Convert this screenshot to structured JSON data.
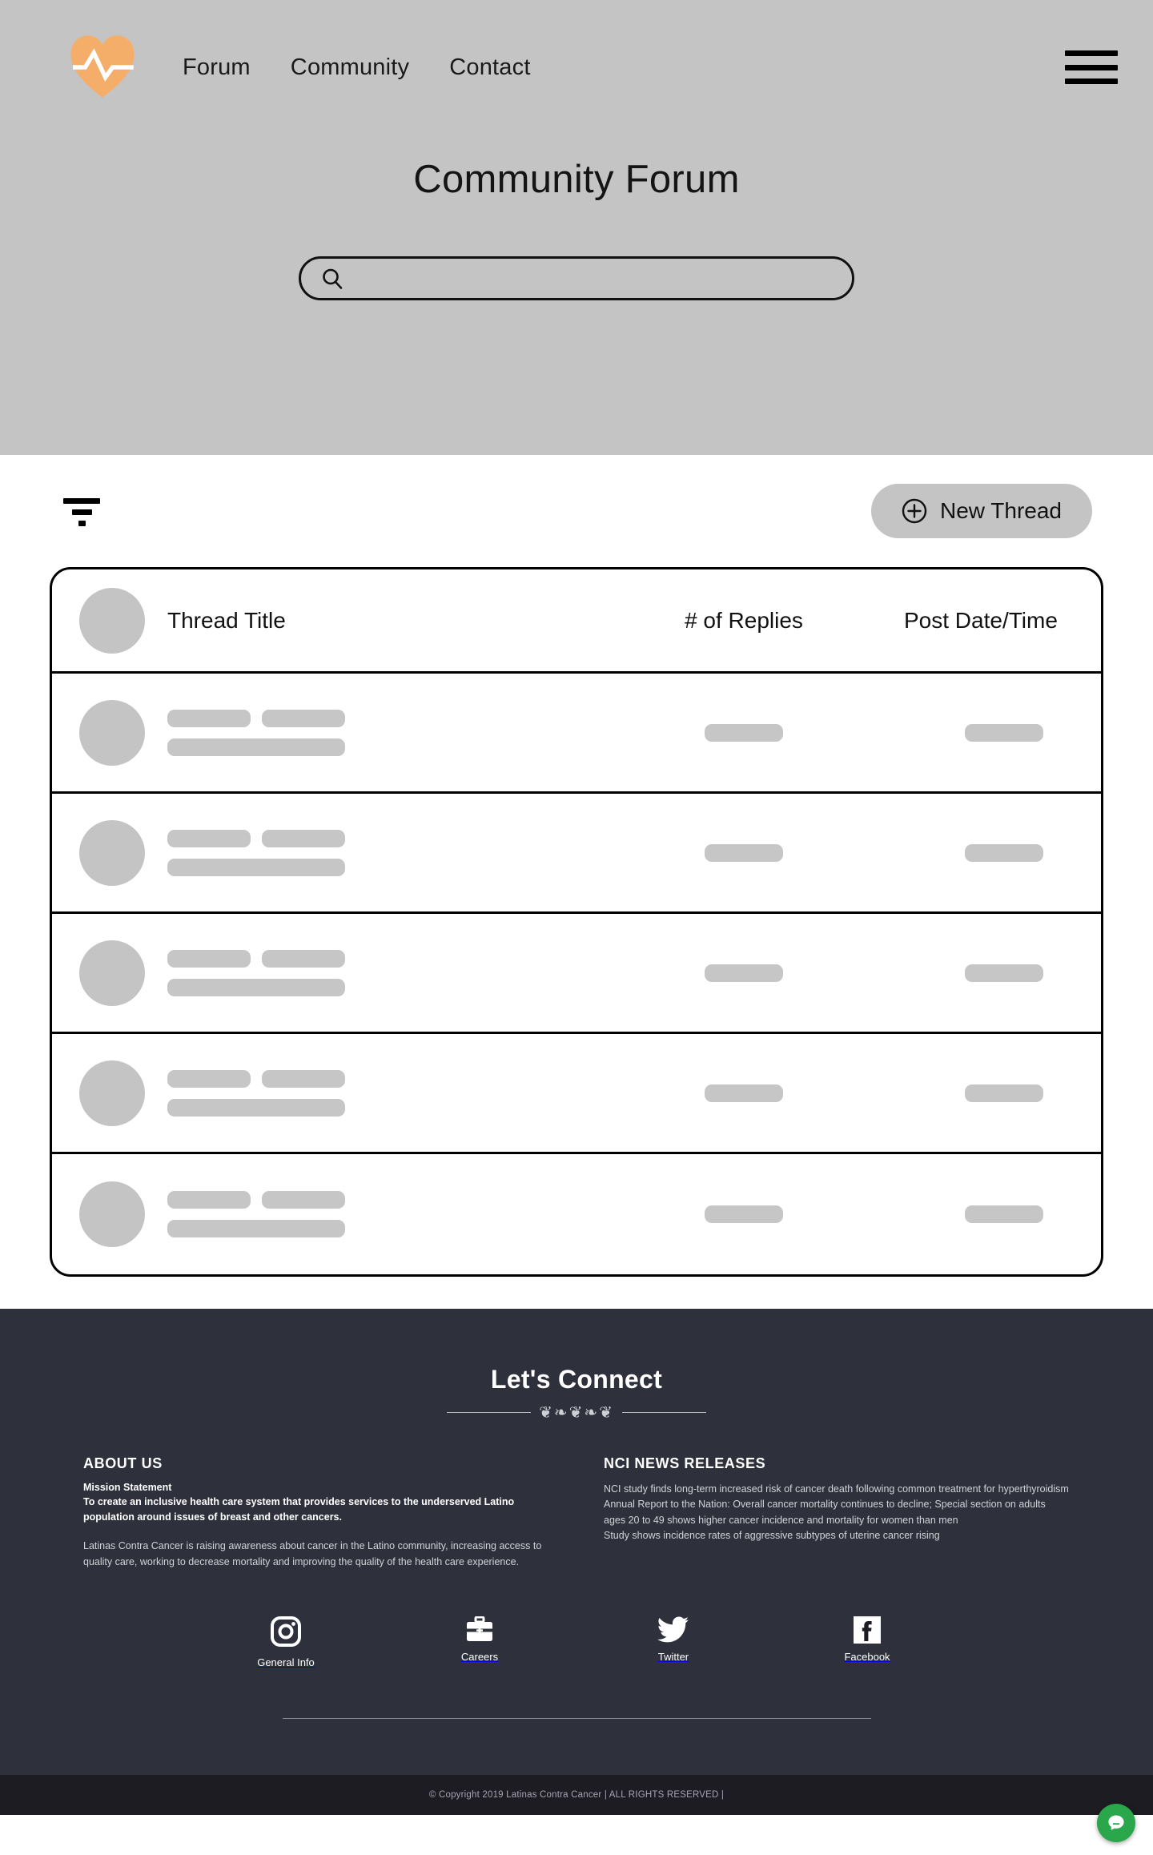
{
  "nav": {
    "logo_alt": "Latinas Contra Cancer heart-pulse logo",
    "links": [
      {
        "label": "Forum"
      },
      {
        "label": "Community"
      },
      {
        "label": "Contact"
      }
    ],
    "menu_label": "Menu"
  },
  "hero": {
    "title": "Community Forum",
    "search_placeholder": "",
    "search_value": ""
  },
  "toolbar": {
    "filter_label": "Filter",
    "new_thread_label": "New Thread"
  },
  "table": {
    "headers": {
      "thread_title": "Thread Title",
      "replies": "# of Replies",
      "date": "Post Date/Time"
    },
    "rows": [
      {
        "id": "row-1"
      },
      {
        "id": "row-2"
      },
      {
        "id": "row-3"
      },
      {
        "id": "row-4"
      },
      {
        "id": "row-5"
      }
    ]
  },
  "footer": {
    "title": "Let's Connect",
    "about": {
      "heading": "ABOUT US",
      "mission_label": "Mission Statement",
      "mission_text": "To create an inclusive health care system that provides services to the underserved Latino population around issues of breast and other cancers.",
      "body": "Latinas Contra Cancer is raising awareness about cancer in the Latino community, increasing access to quality care, working to decrease mortality and improving the quality of the health care experience."
    },
    "news": {
      "heading": "NCI NEWS RELEASES",
      "items": [
        "NCI study finds long-term increased risk of cancer death following common treatment for hyperthyroidism",
        "Annual Report to the Nation: Overall cancer mortality continues to decline; Special section on adults ages 20 to 49 shows higher cancer incidence and mortality for women than men",
        "Study shows incidence rates of aggressive subtypes of uterine cancer rising"
      ]
    },
    "social": [
      {
        "icon": "instagram-icon",
        "label": "General Info"
      },
      {
        "icon": "briefcase-icon",
        "label": "Careers"
      },
      {
        "icon": "twitter-icon",
        "label": "Twitter"
      },
      {
        "icon": "facebook-icon",
        "label": "Facebook"
      }
    ],
    "copyright": "© Copyright 2019 Latinas Contra Cancer |  ALL RIGHTS RESERVED |"
  },
  "chat": {
    "label": "Chat"
  },
  "colors": {
    "banner_bg": "#c4c4c4",
    "accent_orange": "#f5ae6a",
    "footer_bg": "#2e303c",
    "footer_bottom_bg": "#1c1c22",
    "skeleton_gray": "#c6c6c6",
    "chat_green": "#2aa64b",
    "border_black": "#000000"
  }
}
